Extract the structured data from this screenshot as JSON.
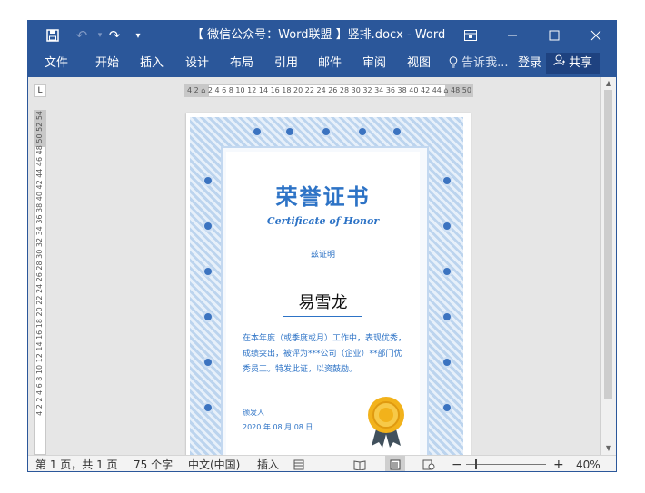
{
  "window": {
    "title": "【 微信公众号：Word联盟 】竖排.docx - Word",
    "qat": {
      "save_icon": "save-icon",
      "undo_icon": "undo-icon",
      "redo_icon": "redo-icon",
      "customize_icon": "customize-qat-icon"
    },
    "controls": {
      "ribbon_display": "ribbon-display-options-icon",
      "minimize": "minimize-icon",
      "maximize": "maximize-icon",
      "close": "close-icon"
    }
  },
  "ribbon": {
    "tabs": [
      "文件",
      "开始",
      "插入",
      "设计",
      "布局",
      "引用",
      "邮件",
      "审阅",
      "视图"
    ],
    "tell_me": "告诉我...",
    "login": "登录",
    "share": "共享"
  },
  "rulers": {
    "horizontal_text": "4 2 ⌂ 2 4 6 8 10 12 14 16 18 20 22 24 26 28 30 32 34 36 38 40 42 44 ⌂ 48 50",
    "vertical_text": "4 2 2 4 6 8 10 12 14 16 18 20 22 24 26 28 30 32 34 36 38 40 42 44 46 48 50 52 54",
    "tab_selector": "L"
  },
  "certificate": {
    "title": "荣誉证书",
    "subtitle": "Certificate of Honor",
    "proof": "兹证明",
    "name": "易雪龙",
    "body": "在本年度（或季度或月）工作中，表现优秀，成绩突出，被评为***公司（企业）**部门优秀员工。特发此证，以资鼓励。",
    "issuer": "颁发人",
    "date": "2020 年 08 月 08 日"
  },
  "status": {
    "page": "第 1 页，共 1 页",
    "words": "75 个字",
    "lang": "中文(中国)",
    "mode": "插入",
    "zoom": "40%"
  },
  "colors": {
    "titlebar": "#2b579a",
    "cert_blue": "#2d73c6",
    "seal_gold": "#f2b21b"
  }
}
